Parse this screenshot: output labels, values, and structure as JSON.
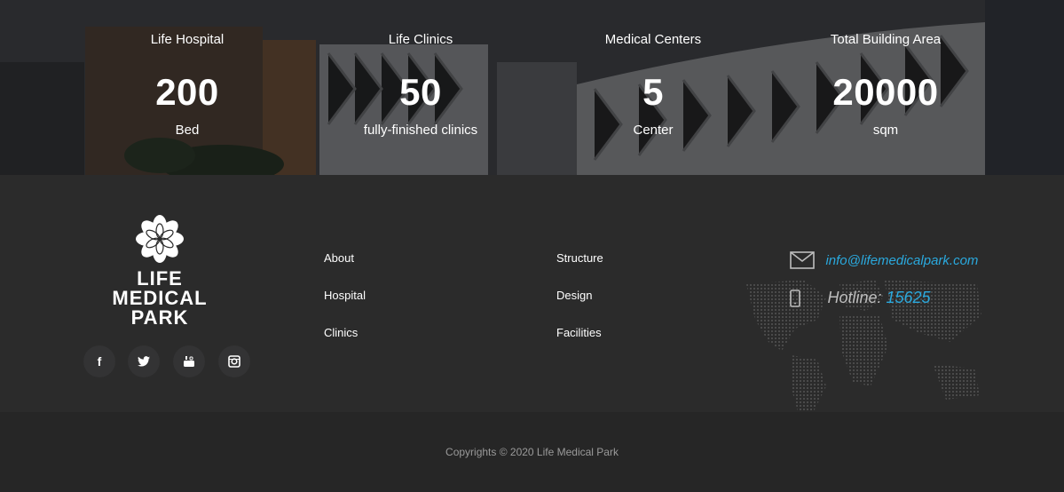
{
  "stats": [
    {
      "label": "Life Hospital",
      "value": "200",
      "unit": "Bed"
    },
    {
      "label": "Life Clinics",
      "value": "50",
      "unit": "fully-finished clinics"
    },
    {
      "label": "Medical Centers",
      "value": "5",
      "unit": "Center"
    },
    {
      "label": "Total Building Area",
      "value": "20000",
      "unit": "sqm"
    }
  ],
  "logo": {
    "line1": "LIFE MEDICAL",
    "line2": "PARK"
  },
  "social": [
    {
      "icon": "facebook-icon",
      "glyph": "f"
    },
    {
      "icon": "twitter-icon",
      "glyph": "t"
    },
    {
      "icon": "youtube-icon",
      "glyph": "▶"
    },
    {
      "icon": "instagram-icon",
      "glyph": "◎"
    }
  ],
  "links_col1": [
    "About",
    "Hospital",
    "Clinics"
  ],
  "links_col2": [
    "Structure",
    "Design",
    "Facilities"
  ],
  "contact": {
    "email": "info@lifemedicalpark.com",
    "hotline_label": "Hotline:",
    "hotline_number": "15625",
    "accent_color": "#2aa9de"
  },
  "copyright": "Copyrights © 2020 Life Medical Park"
}
